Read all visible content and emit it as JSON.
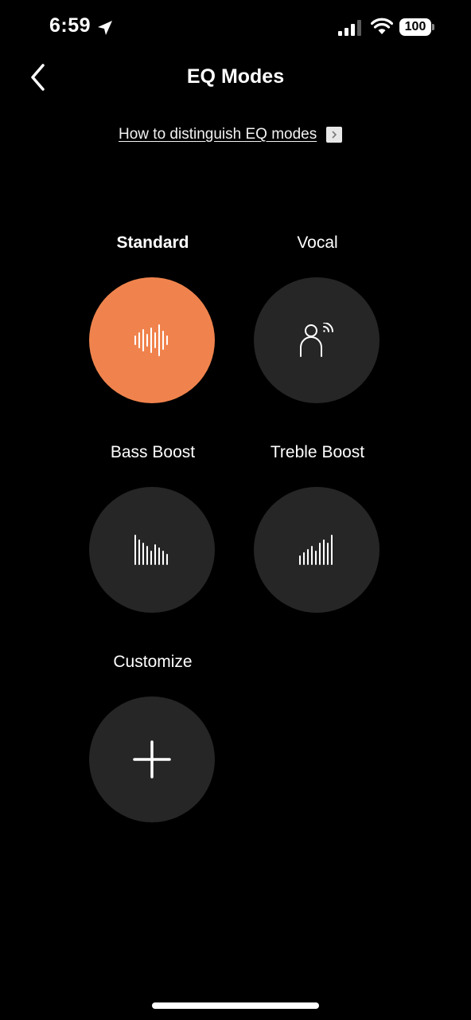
{
  "status_bar": {
    "time": "6:59",
    "battery": "100"
  },
  "header": {
    "title": "EQ Modes"
  },
  "help": {
    "link_text": "How to distinguish EQ modes"
  },
  "modes": [
    {
      "label": "Standard",
      "icon": "waveform-icon",
      "selected": true
    },
    {
      "label": "Vocal",
      "icon": "vocal-person-icon",
      "selected": false
    },
    {
      "label": "Bass Boost",
      "icon": "bass-boost-bars-icon",
      "selected": false
    },
    {
      "label": "Treble Boost",
      "icon": "treble-boost-bars-icon",
      "selected": false
    },
    {
      "label": "Customize",
      "icon": "plus-icon",
      "selected": false
    }
  ],
  "colors": {
    "background": "#000000",
    "accent": "#f0834d",
    "tile": "#262626"
  }
}
